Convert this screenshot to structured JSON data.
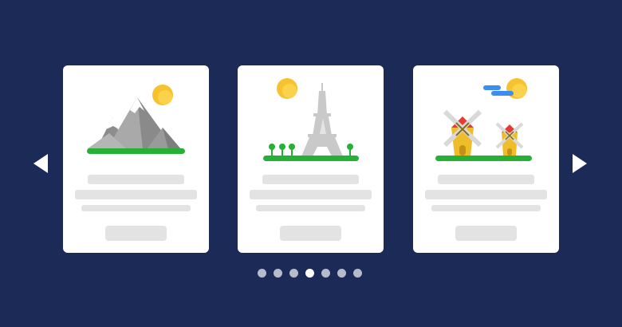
{
  "carousel": {
    "prev_icon": "chevron-left-icon",
    "next_icon": "chevron-right-icon",
    "cards": [
      {
        "illustration": "mountains-with-sun",
        "placeholder_lines": 3,
        "has_button": true
      },
      {
        "illustration": "eiffel-tower-with-sun",
        "placeholder_lines": 3,
        "has_button": true
      },
      {
        "illustration": "windmills-with-sun-and-cloud",
        "placeholder_lines": 3,
        "has_button": true
      }
    ],
    "pagination": {
      "count": 7,
      "active_index": 3
    }
  },
  "colors": {
    "background": "#1b2a57",
    "card": "#ffffff",
    "placeholder": "#e3e3e3",
    "dot_inactive": "#b7bccb",
    "dot_active": "#ffffff",
    "sun": "#f7c22f",
    "grass": "#25b136",
    "cloud": "#3b8ef0",
    "roof_red": "#e73a32"
  }
}
